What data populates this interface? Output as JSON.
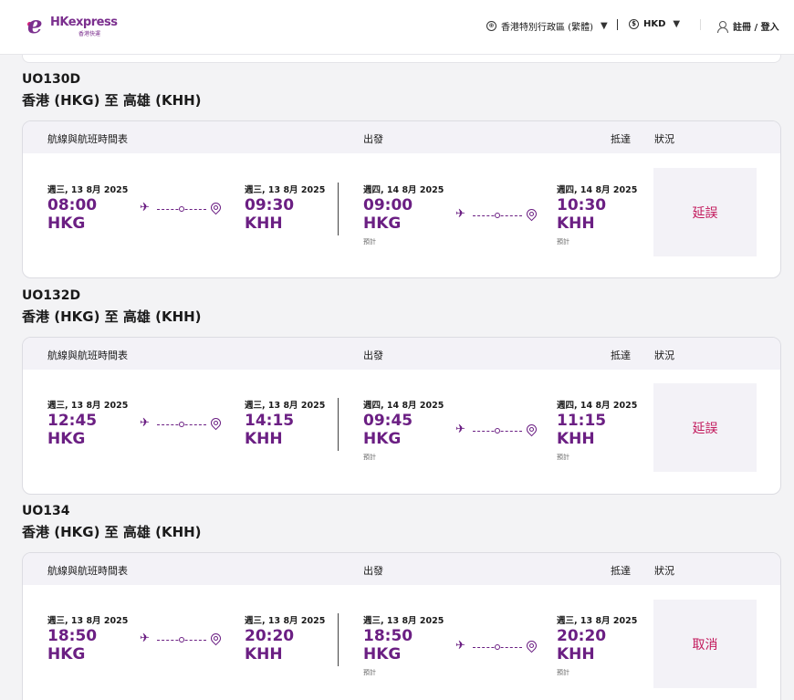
{
  "header": {
    "logo_text": "HKexpress",
    "logo_sub": "香港快運",
    "language": "香港特別行政區 (繁體)",
    "currency": "HKD",
    "login": "註冊 / 登入"
  },
  "table_headers": {
    "schedule": "航線與航班時間表",
    "departure": "出發",
    "arrival": "抵達",
    "status": "狀況"
  },
  "flights": [
    {
      "number": "UO130D",
      "route": "香港 (HKG) 至 高雄 (KHH)",
      "sched_dep": {
        "date": "週三, 13 8月 2025",
        "time": "08:00",
        "code": "HKG"
      },
      "sched_arr": {
        "date": "週三, 13 8月 2025",
        "time": "09:30",
        "code": "KHH"
      },
      "est_dep": {
        "date": "週四, 14 8月 2025",
        "time": "09:00",
        "code": "HKG",
        "note": "預計"
      },
      "est_arr": {
        "date": "週四, 14 8月 2025",
        "time": "10:30",
        "code": "KHH",
        "note": "預計"
      },
      "status": "延誤"
    },
    {
      "number": "UO132D",
      "route": "香港 (HKG) 至 高雄 (KHH)",
      "sched_dep": {
        "date": "週三, 13 8月 2025",
        "time": "12:45",
        "code": "HKG"
      },
      "sched_arr": {
        "date": "週三, 13 8月 2025",
        "time": "14:15",
        "code": "KHH"
      },
      "est_dep": {
        "date": "週四, 14 8月 2025",
        "time": "09:45",
        "code": "HKG",
        "note": "預計"
      },
      "est_arr": {
        "date": "週四, 14 8月 2025",
        "time": "11:15",
        "code": "KHH",
        "note": "預計"
      },
      "status": "延誤"
    },
    {
      "number": "UO134",
      "route": "香港 (HKG) 至 高雄 (KHH)",
      "sched_dep": {
        "date": "週三, 13 8月 2025",
        "time": "18:50",
        "code": "HKG"
      },
      "sched_arr": {
        "date": "週三, 13 8月 2025",
        "time": "20:20",
        "code": "KHH"
      },
      "est_dep": {
        "date": "週三, 13 8月 2025",
        "time": "18:50",
        "code": "HKG",
        "note": "預計"
      },
      "est_arr": {
        "date": "週三, 13 8月 2025",
        "time": "20:20",
        "code": "KHH",
        "note": "預計"
      },
      "status": "取消"
    }
  ]
}
